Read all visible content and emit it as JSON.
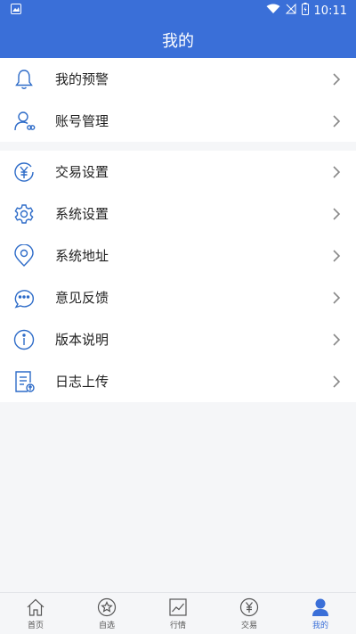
{
  "status": {
    "time": "10:11"
  },
  "header": {
    "title": "我的"
  },
  "group1": [
    {
      "label": "我的预警",
      "icon": "bell-icon"
    },
    {
      "label": "账号管理",
      "icon": "user-account-icon"
    }
  ],
  "group2": [
    {
      "label": "交易设置",
      "icon": "yen-circle-icon"
    },
    {
      "label": "系统设置",
      "icon": "gear-icon"
    },
    {
      "label": "系统地址",
      "icon": "location-pin-icon"
    },
    {
      "label": "意见反馈",
      "icon": "chat-bubble-icon"
    },
    {
      "label": "版本说明",
      "icon": "info-icon"
    },
    {
      "label": "日志上传",
      "icon": "log-upload-icon"
    }
  ],
  "tabs": [
    {
      "label": "首页",
      "icon": "home-icon"
    },
    {
      "label": "自选",
      "icon": "star-icon"
    },
    {
      "label": "行情",
      "icon": "chart-icon"
    },
    {
      "label": "交易",
      "icon": "yen-icon"
    },
    {
      "label": "我的",
      "icon": "person-icon",
      "active": true
    }
  ],
  "colors": {
    "accent": "#3a6fd8",
    "icon": "#2d6bc8"
  }
}
